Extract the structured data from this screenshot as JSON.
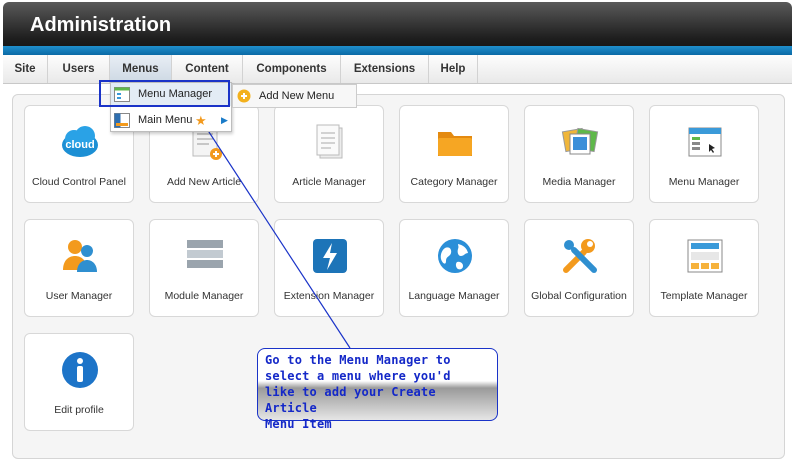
{
  "header": {
    "title": "Administration"
  },
  "menubar": {
    "items": [
      {
        "label": "Site"
      },
      {
        "label": "Users"
      },
      {
        "label": "Menus"
      },
      {
        "label": "Content"
      },
      {
        "label": "Components"
      },
      {
        "label": "Extensions"
      },
      {
        "label": "Help"
      }
    ]
  },
  "dropdown": {
    "items": [
      {
        "label": "Menu Manager",
        "icon": "menu-manager-icon"
      },
      {
        "label": "Main Menu",
        "icon": "main-menu-icon"
      }
    ],
    "submenu": {
      "label": "Add New Menu",
      "icon": "add-icon"
    }
  },
  "tiles": [
    {
      "label": "Cloud Control Panel",
      "icon": "cloud-icon"
    },
    {
      "label": "Add New Article",
      "icon": "add-article-icon"
    },
    {
      "label": "Article Manager",
      "icon": "article-icon"
    },
    {
      "label": "Category Manager",
      "icon": "folder-icon"
    },
    {
      "label": "Media Manager",
      "icon": "media-icon"
    },
    {
      "label": "Menu Manager",
      "icon": "menu-window-icon"
    },
    {
      "label": "User Manager",
      "icon": "users-icon"
    },
    {
      "label": "Module Manager",
      "icon": "module-icon"
    },
    {
      "label": "Extension Manager",
      "icon": "lightning-icon"
    },
    {
      "label": "Language Manager",
      "icon": "globe-icon"
    },
    {
      "label": "Global Configuration",
      "icon": "tools-icon"
    },
    {
      "label": "Template Manager",
      "icon": "template-icon"
    },
    {
      "label": "Edit profile",
      "icon": "info-icon"
    }
  ],
  "callout": {
    "lines": [
      "Go to the Menu Manager to",
      "select a menu where you'd",
      "like to add your Create Article",
      "Menu Item"
    ]
  },
  "colors": {
    "accent": "#1a33c8",
    "header_strip": "#0a6aa6"
  }
}
